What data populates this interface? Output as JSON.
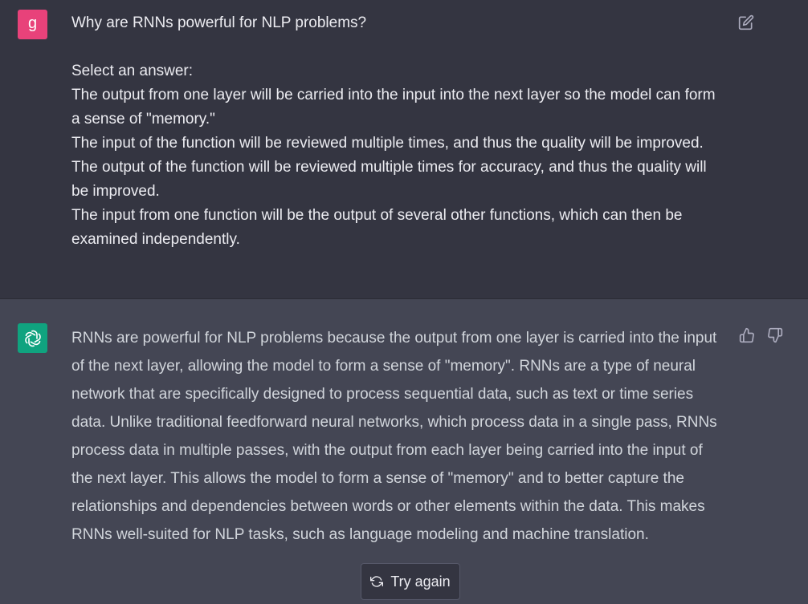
{
  "user_message": {
    "avatar_letter": "g",
    "avatar_color": "#e8427a",
    "question": "Why are RNNs powerful for NLP problems?",
    "prompt": "Select an answer:",
    "options": [
      "The output from one layer will be carried into the input into the next layer so the model can form a sense of \"memory.\"",
      "The input of the function will be reviewed multiple times, and thus the quality will be improved.",
      "The output of the function will be reviewed multiple times for accuracy, and thus the quality will be improved.",
      "The input from one function will be the output of several other functions, which can then be examined independently."
    ],
    "edit_icon": "edit-icon"
  },
  "assistant_message": {
    "avatar_icon": "openai-logo-icon",
    "avatar_color": "#10a37f",
    "text": "RNNs are powerful for NLP problems because the output from one layer is carried into the input of the next layer, allowing the model to form a sense of \"memory\". RNNs are a type of neural network that are specifically designed to process sequential data, such as text or time series data. Unlike traditional feedforward neural networks, which process data in a single pass, RNNs process data in multiple passes, with the output from each layer being carried into the input of the next layer. This allows the model to form a sense of \"memory\" and to better capture the relationships and dependencies between words or other elements within the data. This makes RNNs well-suited for NLP tasks, such as language modeling and machine translation.",
    "thumbs_up_icon": "thumbs-up-icon",
    "thumbs_down_icon": "thumbs-down-icon"
  },
  "try_again": {
    "label": "Try again",
    "icon": "refresh-icon"
  }
}
